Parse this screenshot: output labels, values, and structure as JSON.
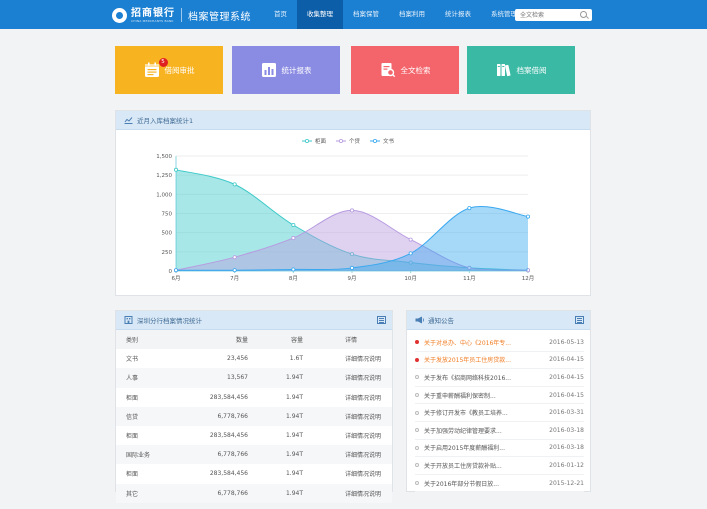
{
  "header": {
    "bank_name": "招商银行",
    "bank_name_en": "CHINA MERCHANTS BANK",
    "system_name": "档案管理系统",
    "nav": [
      {
        "label": "首页",
        "active": false
      },
      {
        "label": "收集整理",
        "active": true
      },
      {
        "label": "档案保管",
        "active": false
      },
      {
        "label": "档案利用",
        "active": false
      },
      {
        "label": "统计报表",
        "active": false
      },
      {
        "label": "系统管理",
        "active": false
      }
    ],
    "search_placeholder": "全文检索"
  },
  "tiles": [
    {
      "label": "借阅审批",
      "badge": "5",
      "color": "#f8b321"
    },
    {
      "label": "统计报表",
      "color": "#8a8be2"
    },
    {
      "label": "全文检索",
      "color": "#f3656b"
    },
    {
      "label": "档案借阅",
      "color": "#3ab9a4"
    }
  ],
  "chart_panel": {
    "title": "近月入库档案统计1"
  },
  "chart_data": {
    "type": "area",
    "categories": [
      "6月",
      "7月",
      "8月",
      "9月",
      "10月",
      "11月",
      "12月"
    ],
    "ylim": [
      0,
      1500
    ],
    "yticks": [
      "0",
      "250",
      "500",
      "750",
      "1,000",
      "1,250",
      "1,500"
    ],
    "legend_position": "top-center",
    "series": [
      {
        "name": "柜面",
        "color": "#3ec9c9",
        "values": [
          1320,
          1130,
          600,
          220,
          110,
          40,
          10
        ]
      },
      {
        "name": "个贷",
        "color": "#b79be0",
        "values": [
          10,
          180,
          430,
          790,
          410,
          40,
          10
        ]
      },
      {
        "name": "文书",
        "color": "#3aa8ef",
        "values": [
          10,
          10,
          20,
          40,
          230,
          820,
          710
        ]
      }
    ]
  },
  "stats_panel": {
    "title": "深圳分行档案情况统计",
    "columns": [
      "类别",
      "数量",
      "容量",
      "详情"
    ],
    "rows": [
      [
        "文书",
        "23,456",
        "1.6T",
        "详细情况说明"
      ],
      [
        "人事",
        "13,567",
        "1.94T",
        "详细情况说明"
      ],
      [
        "柜面",
        "283,584,456",
        "1.94T",
        "详细情况说明"
      ],
      [
        "信贷",
        "6,778,766",
        "1.94T",
        "详细情况说明"
      ],
      [
        "柜面",
        "283,584,456",
        "1.94T",
        "详细情况说明"
      ],
      [
        "国际业务",
        "6,778,766",
        "1.94T",
        "详细情况说明"
      ],
      [
        "柜面",
        "283,584,456",
        "1.94T",
        "详细情况说明"
      ],
      [
        "其它",
        "6,778,766",
        "1.94T",
        "详细情况说明"
      ]
    ]
  },
  "notice_panel": {
    "title": "通知公告",
    "items": [
      {
        "title": "关于对总办、中心《2016年专...",
        "date": "2016-05-13",
        "hot": true
      },
      {
        "title": "关于发放2015年员工住房贷款...",
        "date": "2016-04-15",
        "hot": true
      },
      {
        "title": "关于发布《招商网络科技2016...",
        "date": "2016-04-15",
        "hot": false
      },
      {
        "title": "关于重申薪酬福利保密制...",
        "date": "2016-04-15",
        "hot": false
      },
      {
        "title": "关于修订开发市《教员工培养...",
        "date": "2016-03-31",
        "hot": false
      },
      {
        "title": "关于加强劳动纪律管理要求...",
        "date": "2016-03-18",
        "hot": false
      },
      {
        "title": "关于启用2015年度薪酬福利...",
        "date": "2016-03-18",
        "hot": false
      },
      {
        "title": "关于开放员工住房贷款补贴...",
        "date": "2016-01-12",
        "hot": false
      },
      {
        "title": "关于2016年部分节假日放...",
        "date": "2015-12-21",
        "hot": false
      }
    ]
  }
}
